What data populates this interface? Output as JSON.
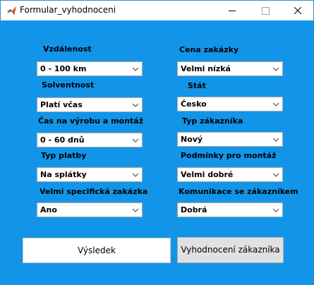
{
  "window": {
    "title": "Formular_vyhodnoceni"
  },
  "left": {
    "fields": [
      {
        "label": "Vzdálenost",
        "value": "0 - 100 km"
      },
      {
        "label": "Solventnost",
        "value": "Platí včas"
      },
      {
        "label": "Čas na výrobu a montáž",
        "value": "0 - 60 dnů"
      },
      {
        "label": "Typ platby",
        "value": "Na splátky"
      },
      {
        "label": "Velmi specifická zakázka",
        "value": "Ano"
      }
    ]
  },
  "right": {
    "fields": [
      {
        "label": "Cena zakázky",
        "value": "Velmi nízká"
      },
      {
        "label": "Stát",
        "value": "Česko"
      },
      {
        "label": "Typ zákazníka",
        "value": "Nový"
      },
      {
        "label": "Podmínky pro montáž",
        "value": "Velmi dobré"
      },
      {
        "label": "Komunikace se zákazníkem",
        "value": "Dobrá"
      }
    ]
  },
  "buttons": {
    "result_label": "Výsledek",
    "evaluate_label": "Vyhodnocení zákazníka"
  },
  "colors": {
    "background": "#1295e9",
    "titlebar": "#ffffff"
  },
  "icons": [
    "matlab-icon",
    "minimize-icon",
    "maximize-icon",
    "close-icon",
    "chevron-down-icon"
  ]
}
